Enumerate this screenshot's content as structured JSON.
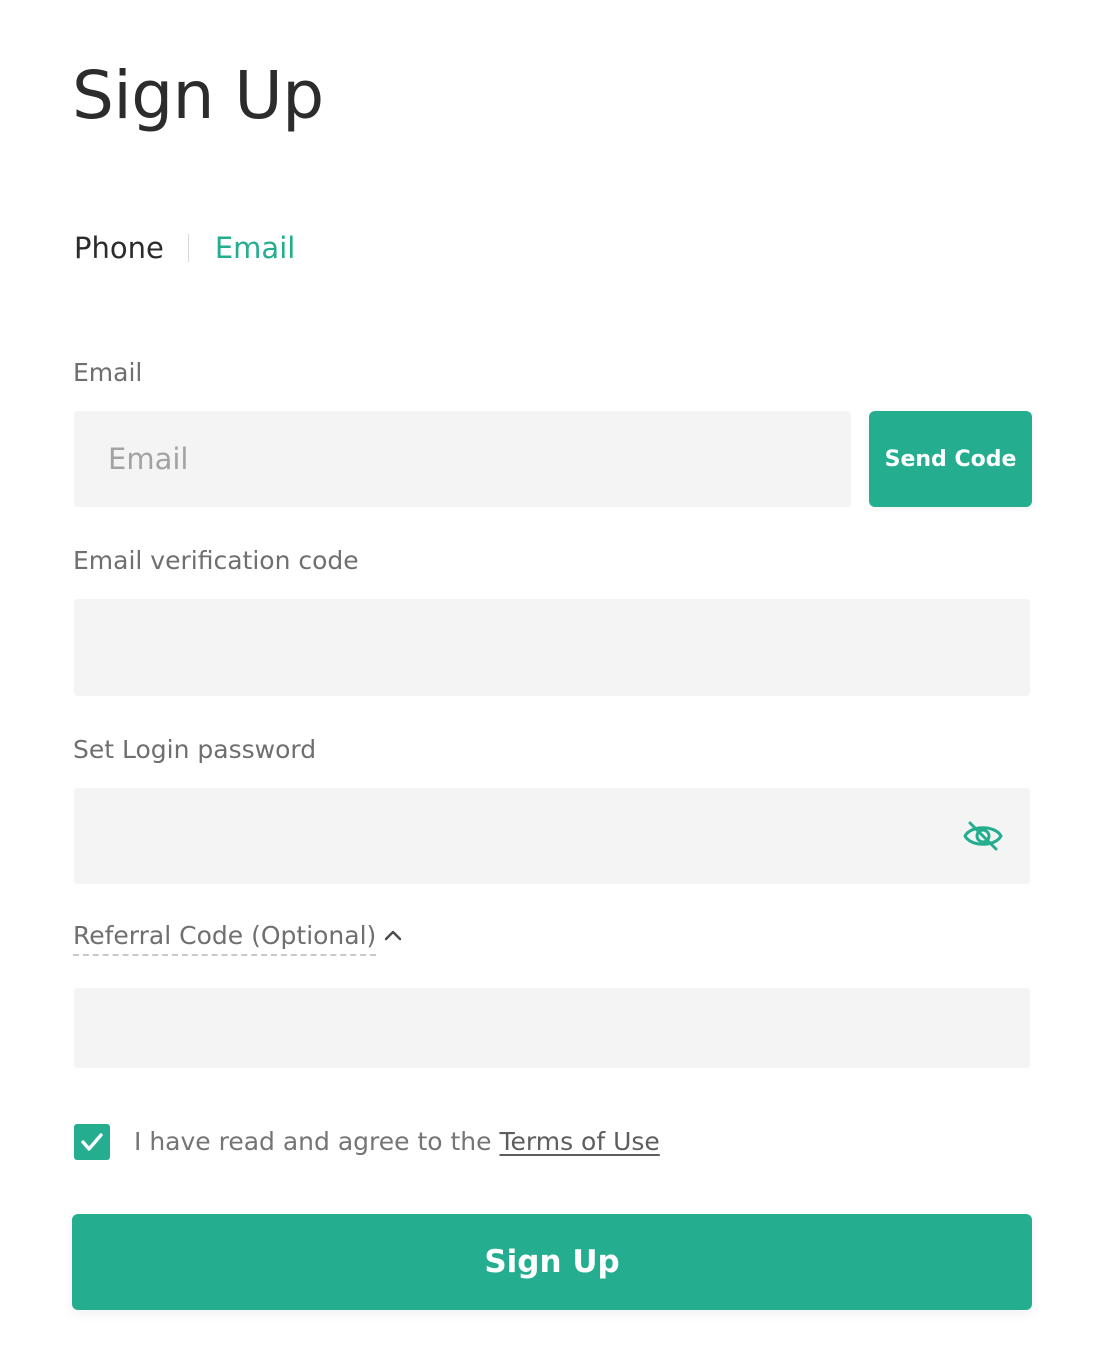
{
  "page": {
    "title": "Sign Up"
  },
  "tabs": {
    "phone": "Phone",
    "email": "Email",
    "active": "Email"
  },
  "form": {
    "email": {
      "label": "Email",
      "placeholder": "Email",
      "value": "",
      "send_code_label": "Send Code"
    },
    "verification": {
      "label": "Email verification code",
      "placeholder": "",
      "value": ""
    },
    "password": {
      "label": "Set Login password",
      "placeholder": "",
      "value": "",
      "visibility_icon": "eye-off-icon"
    },
    "referral": {
      "label": "Referral Code (Optional)",
      "toggle_icon": "chevron-up-icon",
      "expanded": true,
      "placeholder": "",
      "value": ""
    },
    "agreement": {
      "checked": true,
      "text": "I have read and agree to the ",
      "link_text": "Terms of Use"
    },
    "submit_label": "Sign Up"
  },
  "colors": {
    "accent": "#24ae8f",
    "field_bg": "#f4f4f4",
    "label": "#6f6f6f"
  }
}
